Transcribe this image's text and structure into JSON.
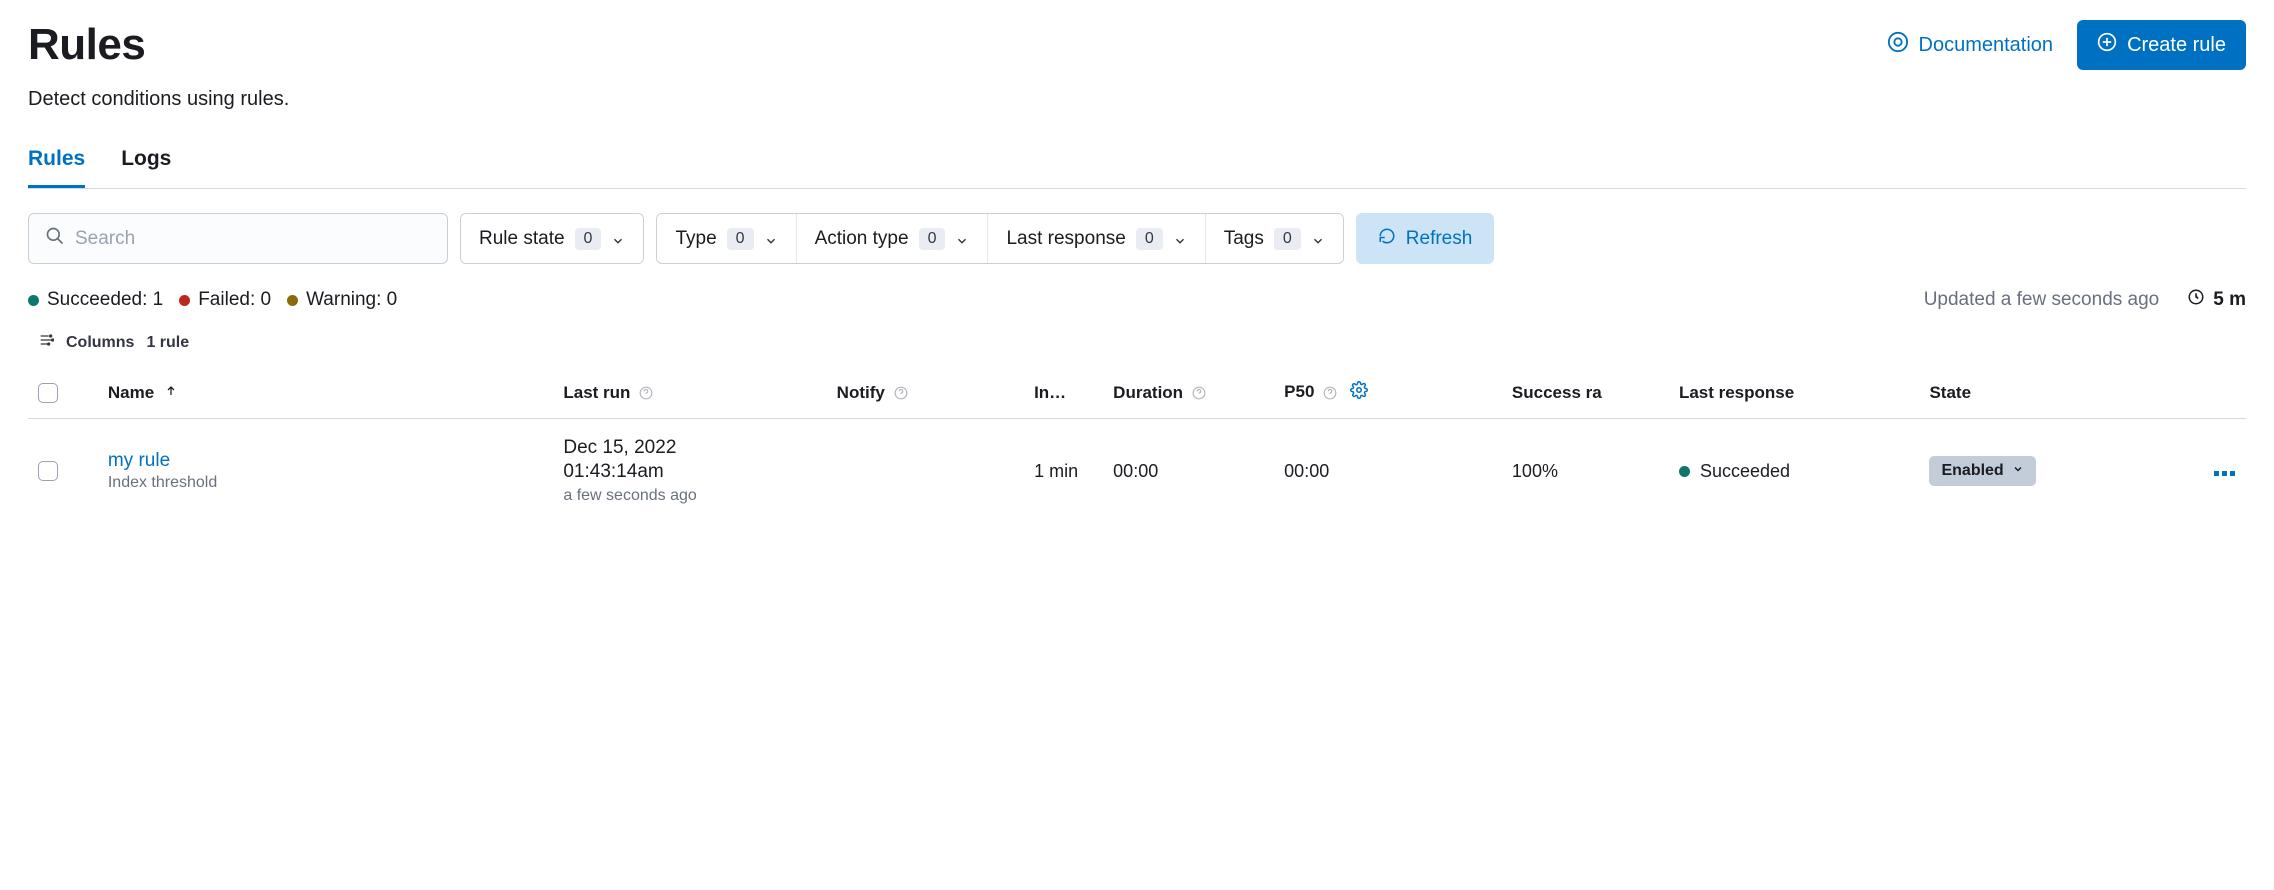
{
  "header": {
    "title": "Rules",
    "subtitle": "Detect conditions using rules.",
    "doc_link": "Documentation",
    "create_button": "Create rule"
  },
  "tabs": {
    "rules": "Rules",
    "logs": "Logs"
  },
  "search": {
    "placeholder": "Search"
  },
  "filters": {
    "rule_state": {
      "label": "Rule state",
      "count": "0"
    },
    "type": {
      "label": "Type",
      "count": "0"
    },
    "action_type": {
      "label": "Action type",
      "count": "0"
    },
    "last_response": {
      "label": "Last response",
      "count": "0"
    },
    "tags": {
      "label": "Tags",
      "count": "0"
    }
  },
  "refresh_label": "Refresh",
  "status": {
    "succeeded": "Succeeded: 1",
    "failed": "Failed: 0",
    "warning": "Warning: 0",
    "updated": "Updated a few seconds ago",
    "timespan": "5 m"
  },
  "meta": {
    "columns_label": "Columns",
    "count_label": "1 rule"
  },
  "columns": {
    "name": "Name",
    "last_run": "Last run",
    "notify": "Notify",
    "interval": "In…",
    "duration": "Duration",
    "p50": "P50",
    "success_rate": "Success ra",
    "last_response": "Last response",
    "state": "State"
  },
  "rows": [
    {
      "name": "my rule",
      "type": "Index threshold",
      "last_run_date": "Dec 15, 2022",
      "last_run_time": "01:43:14am",
      "last_run_ago": "a few seconds ago",
      "interval": "1 min",
      "duration": "00:00",
      "p50": "00:00",
      "success_rate": "100%",
      "last_response": "Succeeded",
      "state": "Enabled"
    }
  ]
}
